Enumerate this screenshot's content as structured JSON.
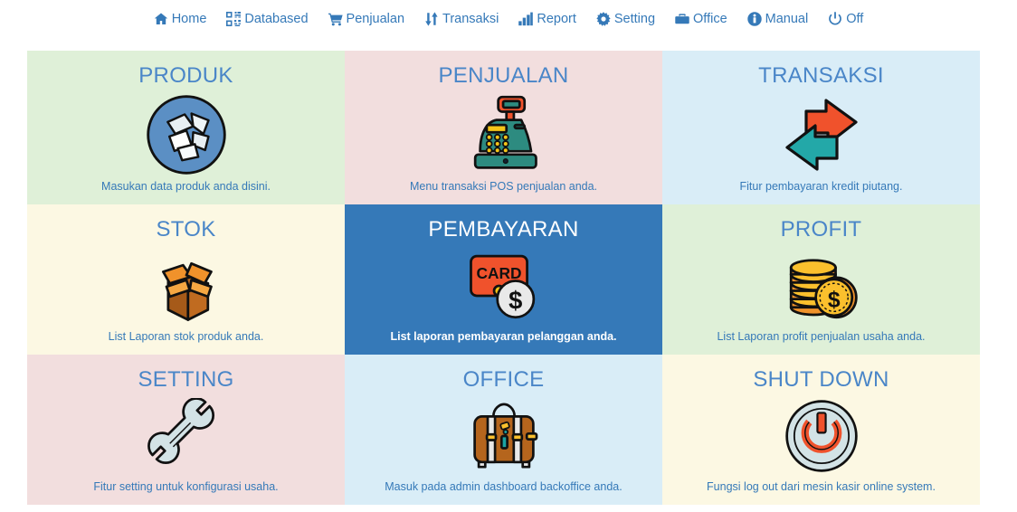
{
  "navbar": {
    "items": [
      {
        "label": "Home",
        "icon": "home-icon"
      },
      {
        "label": "Databased",
        "icon": "qrcode-icon"
      },
      {
        "label": "Penjualan",
        "icon": "shopping-cart-icon"
      },
      {
        "label": "Transaksi",
        "icon": "sort-updown-icon"
      },
      {
        "label": "Report",
        "icon": "bar-chart-icon"
      },
      {
        "label": "Setting",
        "icon": "gear-icon"
      },
      {
        "label": "Office",
        "icon": "briefcase-icon"
      },
      {
        "label": "Manual",
        "icon": "info-circle-icon"
      },
      {
        "label": "Off",
        "icon": "power-icon"
      }
    ]
  },
  "colors": {
    "link_blue": "#3579b8",
    "title_blue": "#4a86c8",
    "active_tile_blue": "#3579b8"
  },
  "tiles": [
    {
      "title": "PRODUK",
      "desc": "Masukan data produk anda disini.",
      "icon": "open-box-circle-icon",
      "bg": "#dff0d8",
      "active": false
    },
    {
      "title": "PENJUALAN",
      "desc": "Menu transaksi POS penjualan anda.",
      "icon": "cash-register-icon",
      "bg": "#f2dede",
      "active": false
    },
    {
      "title": "TRANSAKSI",
      "desc": "Fitur pembayaran kredit piutang.",
      "icon": "two-arrows-exchange-icon",
      "bg": "#d9edf7",
      "active": false
    },
    {
      "title": "STOK",
      "desc": "List Laporan stok produk anda.",
      "icon": "cardboard-box-icon",
      "bg": "#fcf8e3",
      "active": false
    },
    {
      "title": "PEMBAYARAN",
      "desc": "List laporan pembayaran pelanggan anda.",
      "icon": "credit-card-coin-icon",
      "bg": "#3579b8",
      "active": true
    },
    {
      "title": "PROFIT",
      "desc": "List Laporan profit penjualan usaha anda.",
      "icon": "coin-stack-icon",
      "bg": "#dff0d8",
      "active": false
    },
    {
      "title": "SETTING",
      "desc": "Fitur setting untuk konfigurasi usaha.",
      "icon": "wrench-icon",
      "bg": "#f2dede",
      "active": false
    },
    {
      "title": "OFFICE",
      "desc": "Masuk pada admin dashboard backoffice anda.",
      "icon": "suitcase-icon",
      "bg": "#d9edf7",
      "active": false
    },
    {
      "title": "SHUT DOWN",
      "desc": "Fungsi log out dari mesin kasir online system.",
      "icon": "power-button-circle-icon",
      "bg": "#fcf8e3",
      "active": false
    }
  ]
}
